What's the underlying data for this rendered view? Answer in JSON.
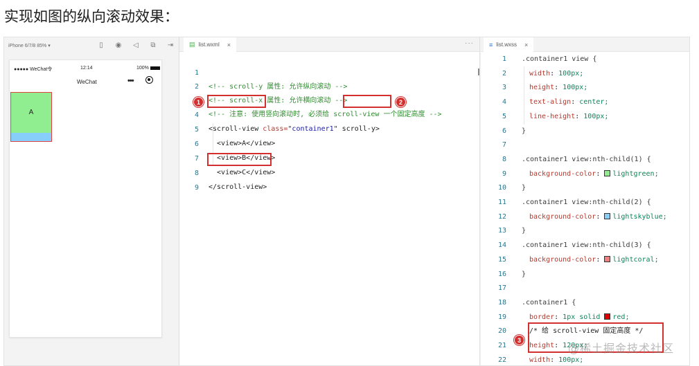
{
  "heading": "实现如图的纵向滚动效果：",
  "simulator": {
    "device": "iPhone 6/7/8 85% ▾",
    "status_left": "●●●●● WeChat令",
    "status_time": "12:14",
    "status_battery": "100%",
    "nav_title": "WeChat",
    "nav_dots": "•••",
    "item_a": "A"
  },
  "wxml_tab": {
    "file": "list.wxml",
    "close": "×",
    "more": "···"
  },
  "wxss_tab": {
    "file": "list.wxss",
    "close": "×"
  },
  "wxml_lines": [
    {
      "n": "1",
      "t": "<!-- scroll-y 属性: 允许纵向滚动 -->"
    },
    {
      "n": "2",
      "t": "<!-- scroll-x 属性: 允许横向滚动 -->"
    },
    {
      "n": "3",
      "t": "<!-- 注意: 使用竖向滚动时, 必须给 scroll-view 一个固定高度 -->"
    },
    {
      "n": "4",
      "t_a": "<scroll-view",
      "t_b": " class=",
      "t_c": "\"container1\"",
      "t_d": " scroll-y>"
    },
    {
      "n": "5",
      "t": "  <view>A</view>"
    },
    {
      "n": "6",
      "t": "  <view>B</view>"
    },
    {
      "n": "7",
      "t": "  <view>C</view>"
    },
    {
      "n": "8",
      "t": "</scroll-view>"
    },
    {
      "n": "9",
      "t": ""
    }
  ],
  "wxss_lines": [
    {
      "n": "1",
      "sel": ".container1 view {"
    },
    {
      "n": "2",
      "prop": "width",
      "val": "100px;"
    },
    {
      "n": "3",
      "prop": "height",
      "val": "100px;"
    },
    {
      "n": "4",
      "prop": "text-align",
      "val": "center;"
    },
    {
      "n": "5",
      "prop": "line-height",
      "val": "100px;"
    },
    {
      "n": "6",
      "sel": "}"
    },
    {
      "n": "7",
      "sel": ""
    },
    {
      "n": "8",
      "sel": ".container1 view:nth-child(1) {"
    },
    {
      "n": "9",
      "prop": "background-color",
      "val": "lightgreen;",
      "swatch": "#90ee90"
    },
    {
      "n": "10",
      "sel": "}"
    },
    {
      "n": "11",
      "sel": ".container1 view:nth-child(2) {"
    },
    {
      "n": "12",
      "prop": "background-color",
      "val": "lightskyblue;",
      "swatch": "#87cefa"
    },
    {
      "n": "13",
      "sel": "}"
    },
    {
      "n": "14",
      "sel": ".container1 view:nth-child(3) {"
    },
    {
      "n": "15",
      "prop": "background-color",
      "val": "lightcoral;",
      "swatch": "#f08080"
    },
    {
      "n": "16",
      "sel": "}"
    },
    {
      "n": "17",
      "sel": ""
    },
    {
      "n": "18",
      "sel": ".container1 {"
    },
    {
      "n": "19",
      "prop": "border",
      "val": "1px solid ",
      "val2": "red;",
      "swatch": "#e00000"
    },
    {
      "n": "20",
      "comment": "/* 给 scroll-view 固定高度 */"
    },
    {
      "n": "21",
      "prop": "height",
      "val": "120px;"
    },
    {
      "n": "22",
      "prop": "width",
      "val": "100px;"
    }
  ],
  "badges": [
    "1",
    "2",
    "3"
  ],
  "watermark": "@稀土掘金技术社区",
  "colors": {
    "annotation": "#d32f2f",
    "comment": "#308c30",
    "property": "#b0392e"
  }
}
